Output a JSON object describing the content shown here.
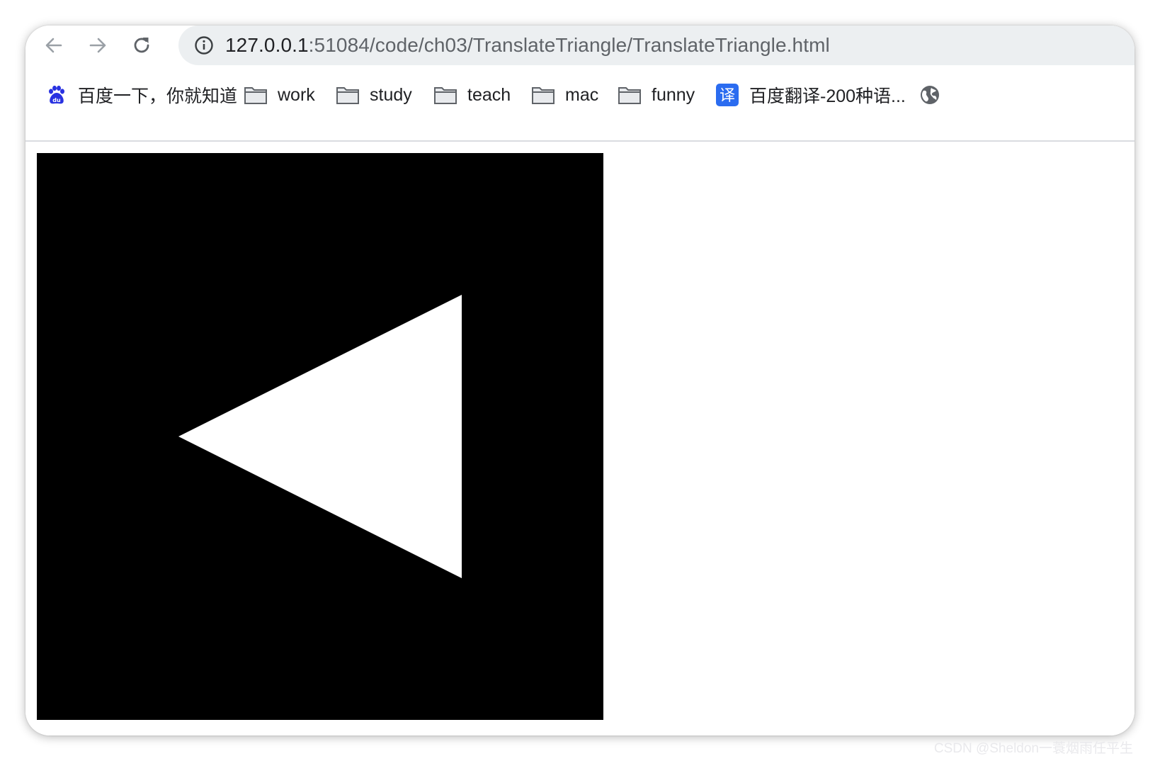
{
  "browser": {
    "url_host": "127.0.0.1",
    "url_rest": ":51084/code/ch03/TranslateTriangle/TranslateTriangle.html"
  },
  "bookmarks": [
    {
      "label": "百度一下，你就知道",
      "icon": "baidu-paw-icon"
    },
    {
      "label": "work",
      "icon": "folder-icon"
    },
    {
      "label": "study",
      "icon": "folder-icon"
    },
    {
      "label": "teach",
      "icon": "folder-icon"
    },
    {
      "label": "mac",
      "icon": "folder-icon"
    },
    {
      "label": "funny",
      "icon": "folder-icon"
    },
    {
      "label": "百度翻译-200种语...",
      "icon": "translate-icon"
    },
    {
      "label": "",
      "icon": "globe-icon"
    }
  ],
  "canvas": {
    "background": "#000000",
    "shape": "triangle",
    "fill": "#ffffff"
  },
  "watermark": "CSDN @Sheldon一蓑烟雨任平生"
}
